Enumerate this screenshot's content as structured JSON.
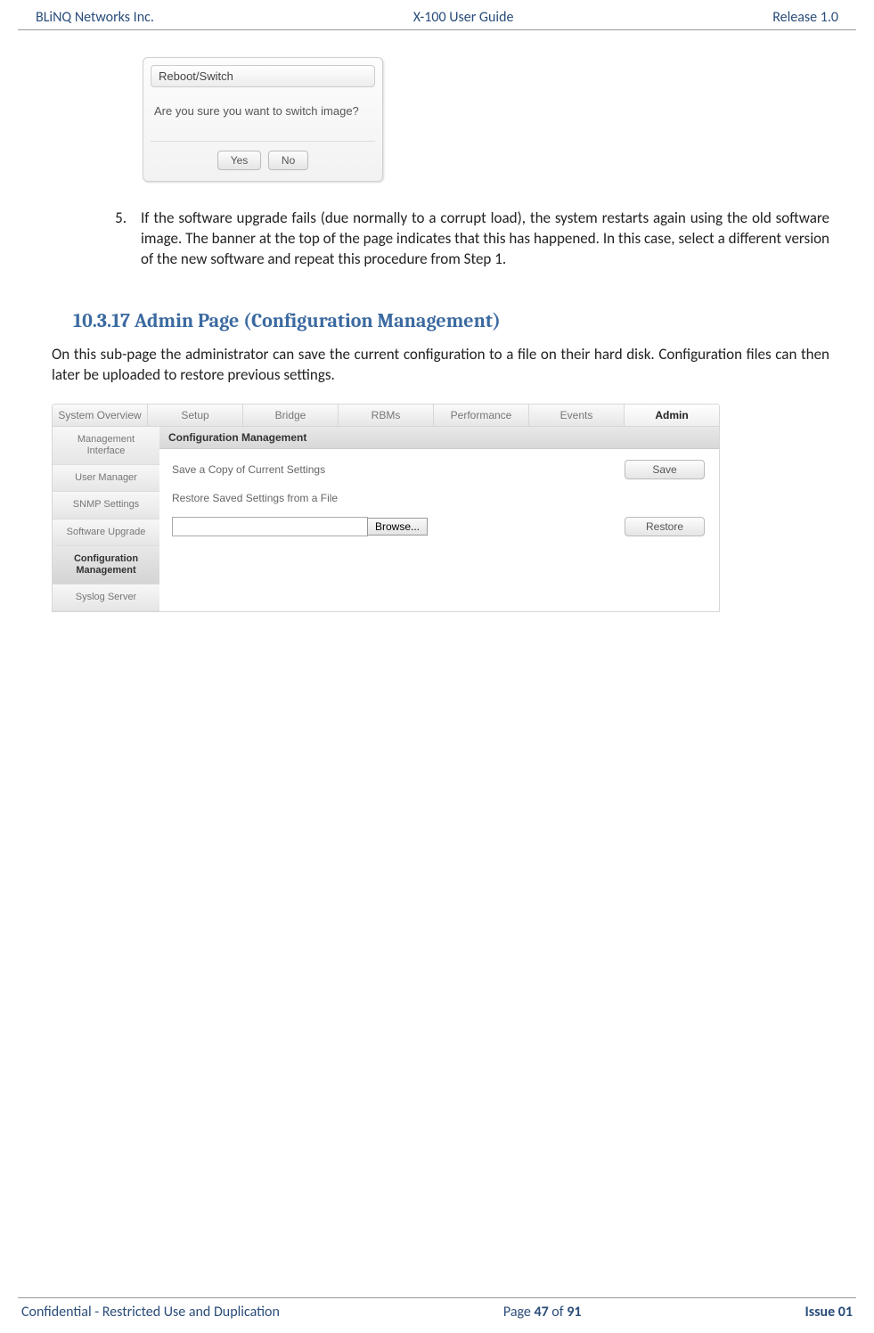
{
  "header": {
    "left": "BLiNQ Networks Inc.",
    "center": "X-100 User Guide",
    "right": "Release 1.0"
  },
  "dialog": {
    "title": "Reboot/Switch",
    "message": "Are you sure you want to switch image?",
    "yes": "Yes",
    "no": "No"
  },
  "step": {
    "num": "5.",
    "text": "If the software upgrade fails (due normally to a corrupt load), the system restarts again using the old software image. The banner at the top of the page indicates that this has happened. In this case, select a different version of the new software and repeat this procedure from Step 1."
  },
  "section": {
    "heading": "10.3.17 Admin Page (Configuration Management)",
    "para": "On this sub-page the administrator can save the current configuration to a file on their hard disk. Configuration files can then later be uploaded to restore previous settings."
  },
  "toptabs": [
    "System Overview",
    "Setup",
    "Bridge",
    "RBMs",
    "Performance",
    "Events",
    "Admin"
  ],
  "toptab_active": "Admin",
  "sidebar": [
    "Management Interface",
    "User Manager",
    "SNMP Settings",
    "Software Upgrade",
    "Configuration Management",
    "Syslog Server"
  ],
  "sidebar_active": "Configuration Management",
  "panel": {
    "header": "Configuration Management",
    "save_label": "Save a Copy of Current Settings",
    "save_btn": "Save",
    "restore_label": "Restore Saved Settings from a File",
    "browse_btn": "Browse...",
    "restore_btn": "Restore"
  },
  "footer": {
    "left": "Confidential - Restricted Use and Duplication",
    "page_prefix": "Page ",
    "page_num": "47",
    "page_mid": " of ",
    "page_total": "91",
    "right": "Issue 01"
  }
}
